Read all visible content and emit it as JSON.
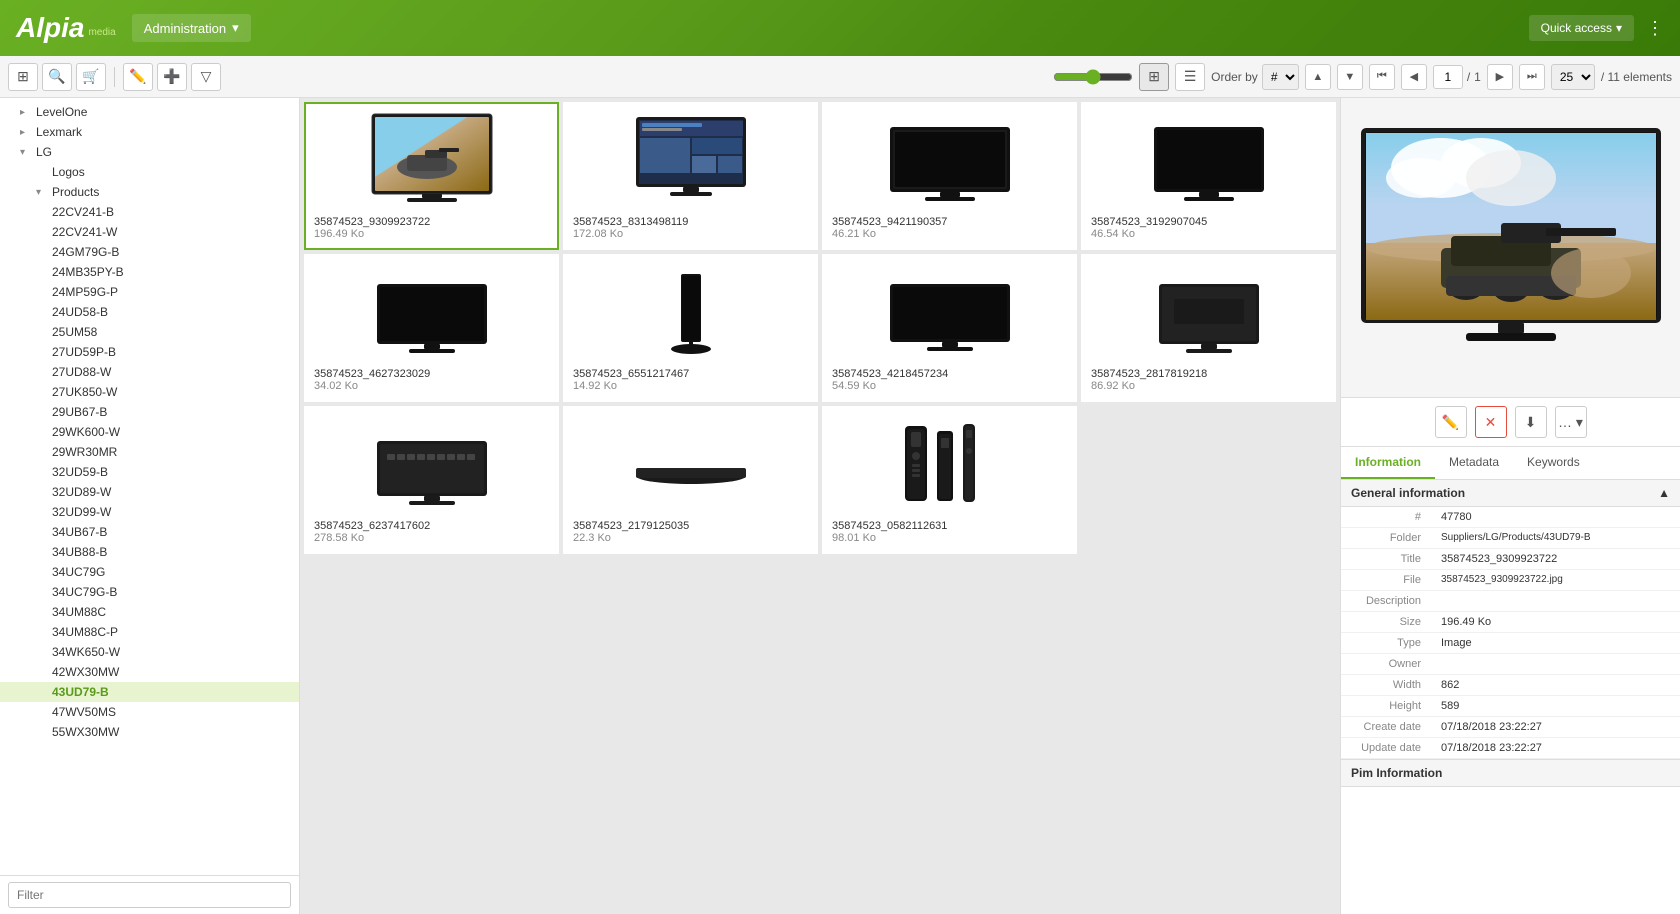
{
  "header": {
    "logo_text": "Alpia",
    "logo_media": "media",
    "admin_label": "Administration",
    "quick_access_label": "Quick access",
    "dropdown_arrow": "▾"
  },
  "toolbar": {
    "order_by_label": "Order by",
    "order_option": "#",
    "page_current": "1",
    "page_total": "1",
    "per_page": "25",
    "elements_label": "/ 11 elements"
  },
  "sidebar": {
    "items": [
      {
        "label": "LevelOne",
        "indent": 1,
        "expanded": false
      },
      {
        "label": "Lexmark",
        "indent": 1,
        "expanded": false
      },
      {
        "label": "LG",
        "indent": 1,
        "expanded": true
      },
      {
        "label": "Logos",
        "indent": 2,
        "expanded": false
      },
      {
        "label": "Products",
        "indent": 2,
        "expanded": true,
        "selected": true
      },
      {
        "label": "22CV241-B",
        "indent": 3
      },
      {
        "label": "22CV241-W",
        "indent": 3
      },
      {
        "label": "24GM79G-B",
        "indent": 3
      },
      {
        "label": "24MB35PY-B",
        "indent": 3
      },
      {
        "label": "24MP59G-P",
        "indent": 3
      },
      {
        "label": "24UD58-B",
        "indent": 3
      },
      {
        "label": "25UM58",
        "indent": 3
      },
      {
        "label": "27UD59P-B",
        "indent": 3
      },
      {
        "label": "27UD88-W",
        "indent": 3
      },
      {
        "label": "27UK850-W",
        "indent": 3
      },
      {
        "label": "29UB67-B",
        "indent": 3
      },
      {
        "label": "29WK600-W",
        "indent": 3
      },
      {
        "label": "29WR30MR",
        "indent": 3
      },
      {
        "label": "32UD59-B",
        "indent": 3
      },
      {
        "label": "32UD89-W",
        "indent": 3
      },
      {
        "label": "32UD99-W",
        "indent": 3
      },
      {
        "label": "34UB67-B",
        "indent": 3
      },
      {
        "label": "34UB88-B",
        "indent": 3
      },
      {
        "label": "34UC79G",
        "indent": 3
      },
      {
        "label": "34UC79G-B",
        "indent": 3
      },
      {
        "label": "34UM88C",
        "indent": 3
      },
      {
        "label": "34UM88C-P",
        "indent": 3
      },
      {
        "label": "34WK650-W",
        "indent": 3
      },
      {
        "label": "42WX30MW",
        "indent": 3
      },
      {
        "label": "43UD79-B",
        "indent": 3,
        "selected": true,
        "bold": true
      },
      {
        "label": "47WV50MS",
        "indent": 3
      },
      {
        "label": "55WX30MW",
        "indent": 3
      }
    ],
    "filter_placeholder": "Filter"
  },
  "grid": {
    "items": [
      {
        "id": 1,
        "title": "35874523_9309923722",
        "size": "196.49 Ko",
        "selected": true
      },
      {
        "id": 2,
        "title": "35874523_8313498119",
        "size": "172.08 Ko"
      },
      {
        "id": 3,
        "title": "35874523_9421190357",
        "size": "46.21 Ko"
      },
      {
        "id": 4,
        "title": "35874523_3192907045",
        "size": "46.54 Ko"
      },
      {
        "id": 5,
        "title": "35874523_4627323029",
        "size": "34.02 Ko"
      },
      {
        "id": 6,
        "title": "35874523_6551217467",
        "size": "14.92 Ko"
      },
      {
        "id": 7,
        "title": "35874523_4218457234",
        "size": "54.59 Ko"
      },
      {
        "id": 8,
        "title": "35874523_2817819218",
        "size": "86.92 Ko"
      },
      {
        "id": 9,
        "title": "35874523_6237417602",
        "size": "278.58 Ko"
      },
      {
        "id": 10,
        "title": "35874523_2179125035",
        "size": "22.3 Ko"
      },
      {
        "id": 11,
        "title": "35874523_0582112631",
        "size": "98.01 Ko"
      }
    ]
  },
  "right_panel": {
    "tabs": [
      "Information",
      "Metadata",
      "Keywords"
    ],
    "active_tab": "Information",
    "section_label": "General information",
    "properties": {
      "hash_label": "#",
      "hash_value": "47780",
      "folder_label": "Folder",
      "folder_value": "Suppliers/LG/Products/43UD79-B",
      "title_label": "Title",
      "title_value": "35874523_9309923722",
      "file_label": "File",
      "file_value": "35874523_9309923722.jpg",
      "description_label": "Description",
      "description_value": "",
      "size_label": "Size",
      "size_value": "196.49 Ko",
      "type_label": "Type",
      "type_value": "Image",
      "owner_label": "Owner",
      "owner_value": "",
      "width_label": "Width",
      "width_value": "862",
      "height_label": "Height",
      "height_value": "589",
      "create_date_label": "Create date",
      "create_date_value": "07/18/2018 23:22:27",
      "update_date_label": "Update date",
      "update_date_value": "07/18/2018 23:22:27"
    },
    "pim_section_label": "Pim Information"
  }
}
